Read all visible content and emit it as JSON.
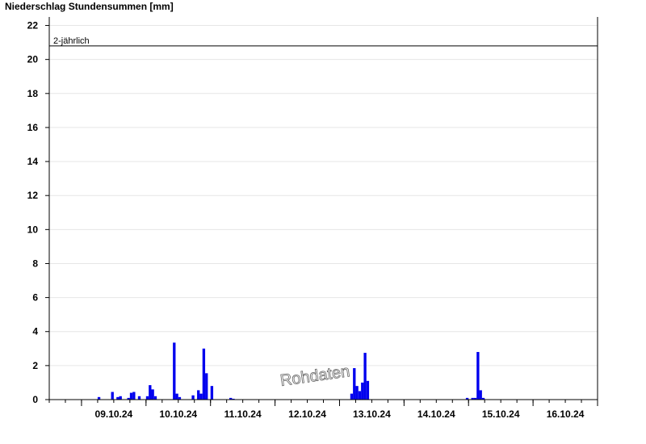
{
  "chart_data": {
    "type": "bar",
    "title": "Niederschlag Stundensummen [mm]",
    "ylim": [
      0,
      22.5
    ],
    "yticks": [
      0,
      2,
      4,
      6,
      8,
      10,
      12,
      14,
      16,
      18,
      20,
      22
    ],
    "xticks": [
      "09.10.24",
      "10.10.24",
      "11.10.24",
      "12.10.24",
      "13.10.24",
      "14.10.24",
      "15.10.24",
      "16.10.24"
    ],
    "grid": true,
    "reference_line": {
      "label": "2-jährlich",
      "value": 20.8
    },
    "watermark": "Rohdaten",
    "bar_color": "#0000ee",
    "x_unit": "hours since 08.10.24 12:00",
    "bars": [
      {
        "x": 18,
        "y": 0.15
      },
      {
        "x": 23,
        "y": 0.45
      },
      {
        "x": 25,
        "y": 0.15
      },
      {
        "x": 26,
        "y": 0.2
      },
      {
        "x": 29,
        "y": 0.1
      },
      {
        "x": 30,
        "y": 0.4
      },
      {
        "x": 31,
        "y": 0.45
      },
      {
        "x": 33,
        "y": 0.2
      },
      {
        "x": 36,
        "y": 0.2
      },
      {
        "x": 37,
        "y": 0.85
      },
      {
        "x": 38,
        "y": 0.6
      },
      {
        "x": 39,
        "y": 0.2
      },
      {
        "x": 46,
        "y": 3.35
      },
      {
        "x": 47,
        "y": 0.35
      },
      {
        "x": 48,
        "y": 0.15
      },
      {
        "x": 53,
        "y": 0.25
      },
      {
        "x": 55,
        "y": 0.55
      },
      {
        "x": 56,
        "y": 0.35
      },
      {
        "x": 57,
        "y": 3.0
      },
      {
        "x": 58,
        "y": 1.55
      },
      {
        "x": 60,
        "y": 0.8
      },
      {
        "x": 67,
        "y": 0.1
      },
      {
        "x": 68,
        "y": 0.05
      },
      {
        "x": 112,
        "y": 0.35
      },
      {
        "x": 113,
        "y": 1.85
      },
      {
        "x": 114,
        "y": 0.8
      },
      {
        "x": 115,
        "y": 0.5
      },
      {
        "x": 116,
        "y": 1.0
      },
      {
        "x": 117,
        "y": 2.75
      },
      {
        "x": 118,
        "y": 1.1
      },
      {
        "x": 155,
        "y": 0.1
      },
      {
        "x": 157,
        "y": 0.1
      },
      {
        "x": 158,
        "y": 0.1
      },
      {
        "x": 159,
        "y": 2.8
      },
      {
        "x": 160,
        "y": 0.55
      },
      {
        "x": 161,
        "y": 0.1
      }
    ]
  }
}
